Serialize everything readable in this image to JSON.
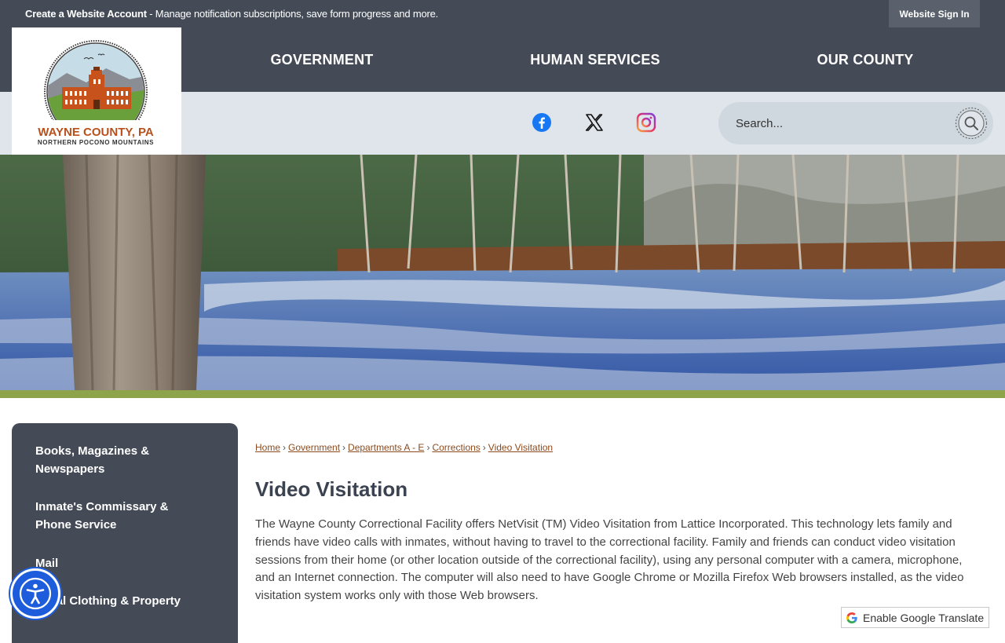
{
  "topbar": {
    "account_strong": "Create a Website Account",
    "account_rest": " - Manage notification subscriptions, save form progress and more.",
    "signin_label": "Website Sign In"
  },
  "logo": {
    "line1": "WAYNE COUNTY, PA",
    "line2": "NORTHERN POCONO MOUNTAINS"
  },
  "nav": {
    "items": [
      {
        "label": "GOVERNMENT"
      },
      {
        "label": "HUMAN SERVICES"
      },
      {
        "label": "OUR COUNTY"
      }
    ]
  },
  "social": {
    "icons": [
      "facebook-icon",
      "x-icon",
      "instagram-icon"
    ]
  },
  "search": {
    "placeholder": "Search..."
  },
  "sidebar": {
    "items": [
      {
        "label_line1": "Books, Magazines &",
        "label_line2": "Newspapers"
      },
      {
        "label_line1": "Inmate's Commissary &",
        "label_line2": "Phone Service"
      },
      {
        "label_line1": "Mail",
        "label_line2": ""
      },
      {
        "label_line1": "sonal Clothing & Property",
        "label_line2": ""
      }
    ]
  },
  "breadcrumb": {
    "items": [
      "Home",
      "Government",
      "Departments A - E",
      "Corrections",
      "Video Visitation"
    ],
    "separator": "›"
  },
  "page": {
    "title": "Video Visitation",
    "body": "The Wayne County Correctional Facility offers NetVisit (TM) Video Visitation from Lattice Incorporated. This technology lets family and friends have video calls with inmates, without having to travel to the correctional facility. Family and friends can conduct video visitation sessions from their home (or other location outside of the correctional facility), using any personal computer with a camera, microphone, and an Internet connection. The computer will also need to have Google Chrome or Mozilla Firefox Web browsers installed, as the video visitation system works only with those Web browsers."
  },
  "translate": {
    "label": "Enable Google Translate"
  },
  "colors": {
    "nav_bg": "#444b57",
    "strip_bg": "#dfe5ea",
    "accent_green": "#8ea44b",
    "link_brown": "#8c4a1d",
    "a11y_blue": "#1d5ddb"
  }
}
